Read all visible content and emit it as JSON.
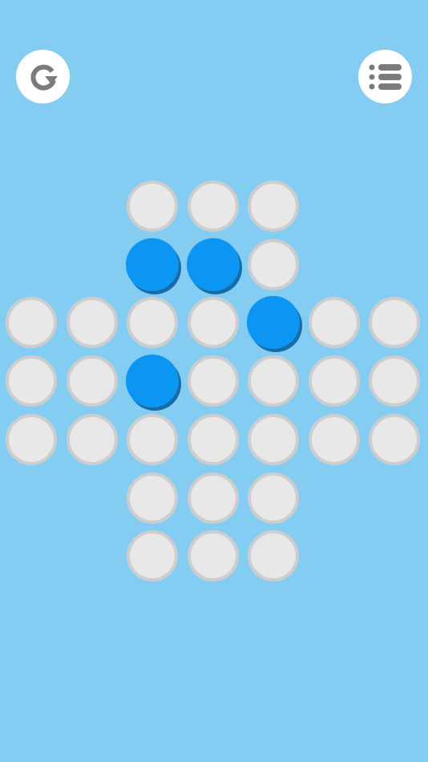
{
  "toolbar": {
    "restart_icon": "restart-icon",
    "menu_icon": "level-list-icon"
  },
  "colors": {
    "background": "#84cdf2",
    "hole_fill": "#e8e8e8",
    "hole_ring": "#cdcdcd",
    "peg": "#0a96f2",
    "peg_shadow": "#1a6aa3",
    "button": "#ffffff",
    "icon": "#7b7b7b"
  },
  "board": {
    "rows": [
      [
        0,
        0,
        1,
        1,
        1,
        0,
        0
      ],
      [
        0,
        0,
        2,
        2,
        1,
        0,
        0
      ],
      [
        1,
        1,
        1,
        1,
        2,
        1,
        1
      ],
      [
        1,
        1,
        2,
        1,
        1,
        1,
        1
      ],
      [
        1,
        1,
        1,
        1,
        1,
        1,
        1
      ],
      [
        0,
        0,
        1,
        1,
        1,
        0,
        0
      ],
      [
        0,
        0,
        1,
        1,
        1,
        0,
        0
      ]
    ],
    "legend": {
      "0": "none",
      "1": "empty-hole",
      "2": "peg"
    }
  }
}
